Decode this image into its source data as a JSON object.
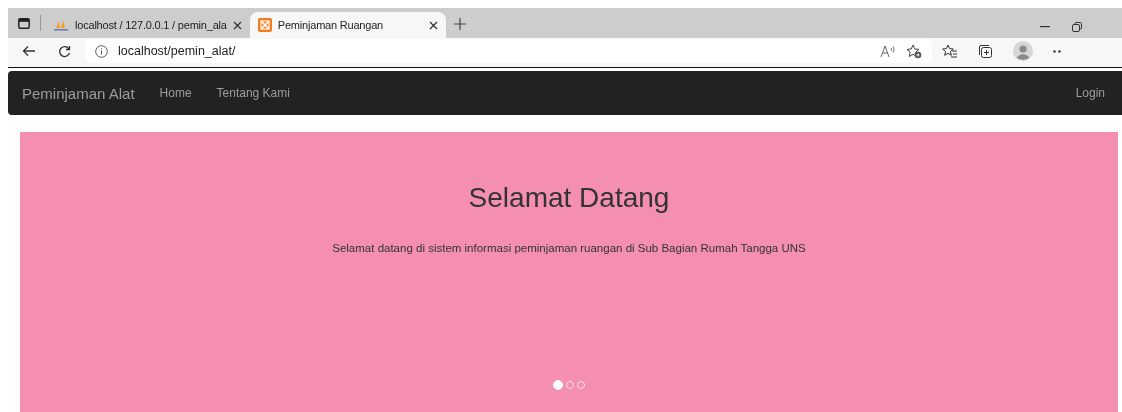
{
  "browser": {
    "tabs": [
      {
        "title": "localhost / 127.0.0.1 / pemin_ala",
        "selected": false
      },
      {
        "title": "Peminjaman Ruangan",
        "selected": true
      }
    ],
    "url": "localhost/pemin_alat/"
  },
  "navbar": {
    "brand": "Peminjaman Alat",
    "links": [
      "Home",
      "Tentang Kami"
    ],
    "right_link": "Login"
  },
  "jumbotron": {
    "title": "Selamat Datang",
    "text": "Selamat datang di sistem informasi peminjaman ruangan di Sub Bagian Rumah Tangga UNS",
    "indicators": [
      {
        "selected": true
      },
      {
        "selected": false
      },
      {
        "selected": false
      }
    ]
  }
}
